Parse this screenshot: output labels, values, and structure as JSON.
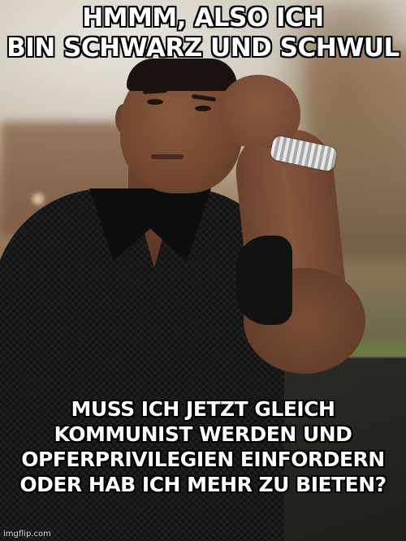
{
  "meme": {
    "top_text": "HMMM, ALSO ICH\nBIN SCHWARZ UND SCHWUL",
    "bottom_text": "MUSS ICH JETZT GLEICH\nKOMMUNIST WERDEN UND\nOPFERPRIVILEGIEN EINFORDERN\nODER HAB ICH MEHR ZU BIETEN?",
    "watermark": "imgflip.com"
  },
  "colors": {
    "caption_fill": "#ffffff",
    "caption_outline": "#000000",
    "shirt": "#141414",
    "skin": "#74492f"
  }
}
